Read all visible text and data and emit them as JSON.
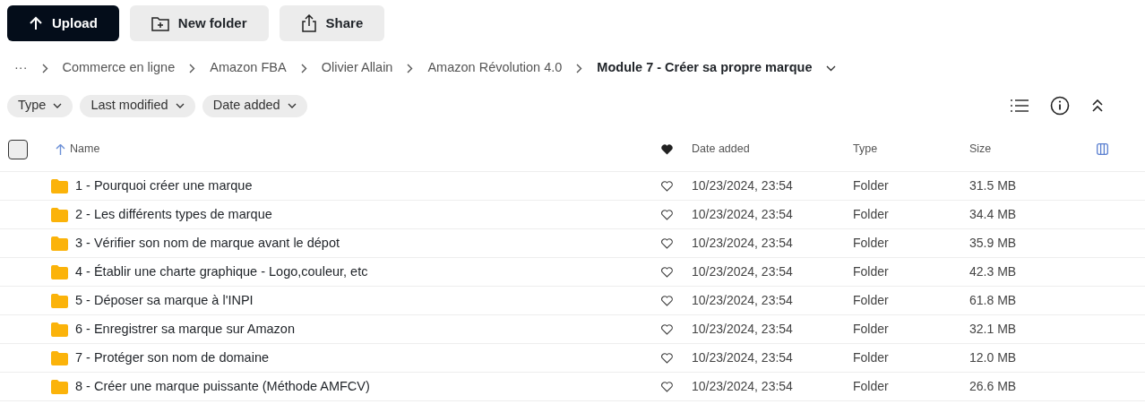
{
  "toolbar": [
    {
      "label": "Upload",
      "kind": "upload",
      "primary": true
    },
    {
      "label": "New folder",
      "kind": "folder",
      "primary": false
    },
    {
      "label": "Share",
      "kind": "share",
      "primary": false
    }
  ],
  "breadcrumb": {
    "overflow": "···",
    "items": [
      {
        "label": "Commerce en ligne",
        "current": false
      },
      {
        "label": "Amazon FBA",
        "current": false
      },
      {
        "label": "Olivier Allain",
        "current": false
      },
      {
        "label": "Amazon Révolution 4.0",
        "current": false
      },
      {
        "label": "Module 7 - Créer sa propre marque",
        "current": true
      }
    ]
  },
  "filters": [
    "Type",
    "Last modified",
    "Date added"
  ],
  "table": {
    "select_all": {
      "checked": false
    },
    "columns": {
      "name": "Name",
      "date": "Date added",
      "type": "Type",
      "size": "Size"
    },
    "rows": [
      {
        "name": "1 - Pourquoi créer une marque",
        "favorite": false,
        "date": "10/23/2024, 23:54",
        "type": "Folder",
        "size": "31.5 MB"
      },
      {
        "name": "2 - Les différents types de marque",
        "favorite": false,
        "date": "10/23/2024, 23:54",
        "type": "Folder",
        "size": "34.4 MB"
      },
      {
        "name": "3 - Vérifier son nom de marque avant le dépot",
        "favorite": false,
        "date": "10/23/2024, 23:54",
        "type": "Folder",
        "size": "35.9 MB"
      },
      {
        "name": "4 - Établir une charte graphique - Logo,couleur, etc",
        "favorite": false,
        "date": "10/23/2024, 23:54",
        "type": "Folder",
        "size": "42.3 MB"
      },
      {
        "name": "5 - Déposer sa marque à l'INPI",
        "favorite": false,
        "date": "10/23/2024, 23:54",
        "type": "Folder",
        "size": "61.8 MB"
      },
      {
        "name": "6 - Enregistrer sa marque sur Amazon",
        "favorite": false,
        "date": "10/23/2024, 23:54",
        "type": "Folder",
        "size": "32.1 MB"
      },
      {
        "name": "7 - Protéger son nom de domaine",
        "favorite": false,
        "date": "10/23/2024, 23:54",
        "type": "Folder",
        "size": "12.0 MB"
      },
      {
        "name": "8 - Créer une marque puissante (Méthode AMFCV)",
        "favorite": false,
        "date": "10/23/2024, 23:54",
        "type": "Folder",
        "size": "26.6 MB"
      }
    ]
  }
}
